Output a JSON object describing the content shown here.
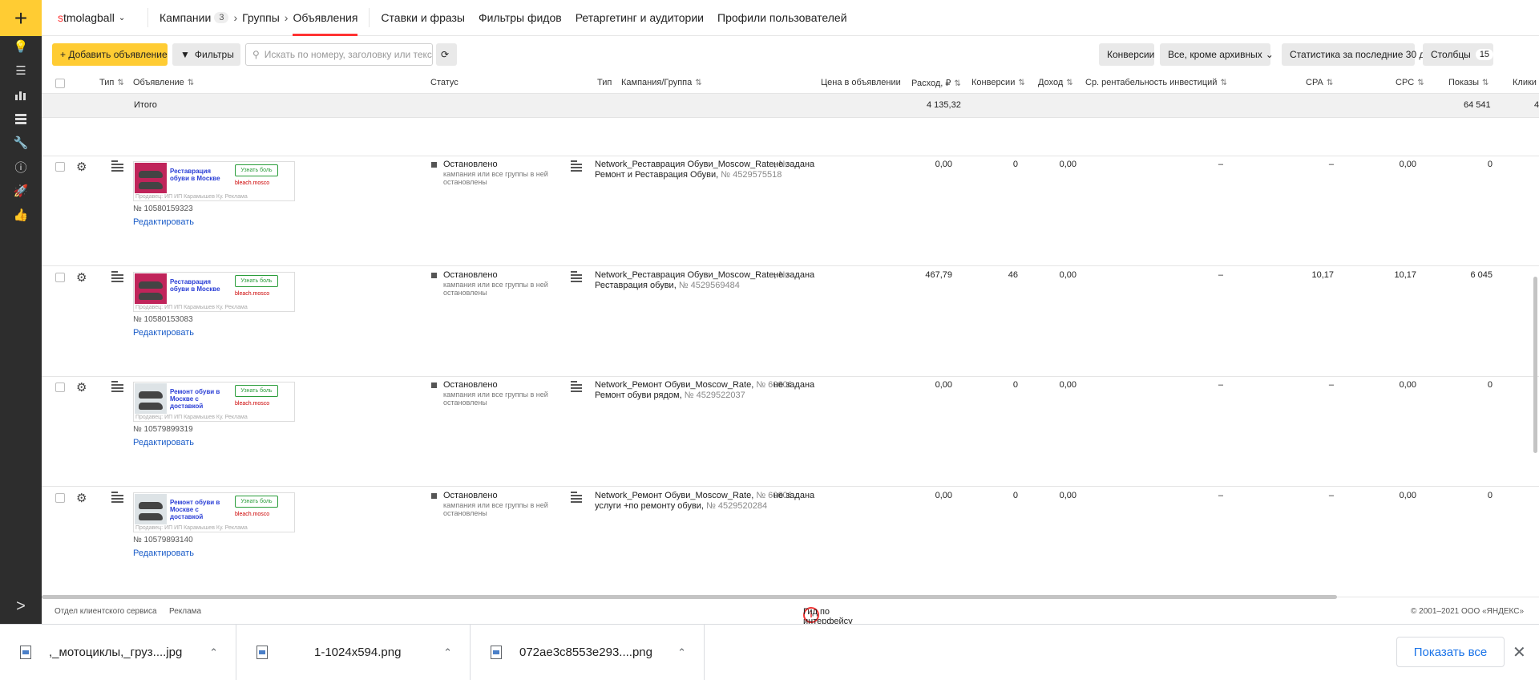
{
  "sidebar": {
    "add_symbol": "+",
    "icons": [
      "lightbulb-icon",
      "list-icon",
      "bar-chart-icon",
      "stack-icon",
      "wrench-icon",
      "info-icon",
      "rocket-icon",
      "thumb-up-icon"
    ],
    "expand_symbol": ">"
  },
  "topnav": {
    "login_first": "s",
    "login_rest": "tmolagball",
    "crumbs": {
      "campaigns": "Кампании",
      "campaigns_count": "3",
      "groups": "Группы",
      "ads": "Объявления"
    },
    "links": [
      "Ставки и фразы",
      "Фильтры фидов",
      "Ретаргетинг и аудитории",
      "Профили пользователей"
    ]
  },
  "toolbar": {
    "add_ad": "+ Добавить объявление",
    "filters": "Фильтры",
    "search_placeholder": "Искать по номеру, заголовку или тексту",
    "conversions": "Конверсии",
    "archive_filter": "Все, кроме архивных",
    "stats_period": "Статистика за последние 30 дней",
    "columns": "Столбцы",
    "columns_count": "15"
  },
  "table": {
    "headers": {
      "type_short": "Тип",
      "ad": "Объявление",
      "status": "Статус",
      "type": "Тип",
      "campaign_group": "Кампания/Группа",
      "price": "Цена в объявлении",
      "spend": "Расход, ₽",
      "conversions": "Конверсии",
      "income": "Доход",
      "roi": "Ср. рентабельность инвестиций",
      "cpa": "CPA",
      "cpc": "CPC",
      "impressions": "Показы",
      "clicks": "Клики"
    },
    "totals": {
      "label": "Итого",
      "spend": "4 135,32",
      "impressions": "64 541",
      "clicks_partial": "4"
    },
    "rows": [
      {
        "ad_title": "Реставрация обуви в Москве",
        "ad_cta": "Узнать боль",
        "ad_domain": "bleach.mosco",
        "ad_seller": "Продавец: ИП ИП Карамышев Ку. Реклама",
        "ad_number": "№ 10580159323",
        "edit": "Редактировать",
        "status": "Остановлено",
        "status_sub": "кампания или все группы в ней остановлены",
        "campaign": "Network_Реставрация Обуви_Moscow_Rate,",
        "campaign_num": "№ 6",
        "group": "Ремонт и Реставрация Обуви,",
        "group_num": "№ 4529575518",
        "price": "не задана",
        "spend": "0,00",
        "conversions": "0",
        "income": "0,00",
        "roi": "–",
        "cpa": "–",
        "cpc": "0,00",
        "impressions": "0",
        "image": "pink"
      },
      {
        "ad_title": "Реставрация обуви в Москве",
        "ad_cta": "Узнать боль",
        "ad_domain": "bleach.mosco",
        "ad_seller": "Продавец: ИП ИП Карамышев Ку. Реклама",
        "ad_number": "№ 10580153083",
        "edit": "Редактировать",
        "status": "Остановлено",
        "status_sub": "кампания или все группы в ней остановлены",
        "campaign": "Network_Реставрация Обуви_Moscow_Rate,",
        "campaign_num": "№ 6",
        "group": "Реставрация обуви,",
        "group_num": "№ 4529569484",
        "price": "не задана",
        "spend": "467,79",
        "conversions": "46",
        "income": "0,00",
        "roi": "–",
        "cpa": "10,17",
        "cpc": "10,17",
        "impressions": "6 045",
        "image": "pink"
      },
      {
        "ad_title": "Ремонт обуви в Москве с доставкой",
        "ad_cta": "Узнать боль",
        "ad_domain": "bleach.mosco",
        "ad_seller": "Продавец: ИП ИП Карамышев Ку. Реклама",
        "ad_number": "№ 10579899319",
        "edit": "Редактировать",
        "status": "Остановлено",
        "status_sub": "кампания или все группы в ней остановлены",
        "campaign": "Network_Ремонт Обуви_Moscow_Rate,",
        "campaign_num": "№ 60606",
        "group": "Ремонт обуви рядом,",
        "group_num": "№ 4529522037",
        "price": "не задана",
        "spend": "0,00",
        "conversions": "0",
        "income": "0,00",
        "roi": "–",
        "cpa": "–",
        "cpc": "0,00",
        "impressions": "0",
        "image": "grey"
      },
      {
        "ad_title": "Ремонт обуви в Москве с доставкой",
        "ad_cta": "Узнать боль",
        "ad_domain": "bleach.mosco",
        "ad_seller": "Продавец: ИП ИП Карамышев Ку. Реклама",
        "ad_number": "№ 10579893140",
        "edit": "Редактировать",
        "status": "Остановлено",
        "status_sub": "кампания или все группы в ней остановлены",
        "campaign": "Network_Ремонт Обуви_Moscow_Rate,",
        "campaign_num": "№ 60606",
        "group": "услуги +по ремонту обуви,",
        "group_num": "№ 4529520284",
        "price": "не задана",
        "spend": "0,00",
        "conversions": "0",
        "income": "0,00",
        "roi": "–",
        "cpa": "–",
        "cpc": "0,00",
        "impressions": "0",
        "image": "grey"
      }
    ]
  },
  "footer": {
    "support": "Отдел клиентского сервиса",
    "ads": "Реклама",
    "guide": "Гид по интерфейсу",
    "copyright": "© 2001–2021  ООО «ЯНДЕКС»"
  },
  "downloads": {
    "items": [
      ",_мотоциклы,_груз....jpg",
      "1-1024x594.png",
      "072ae3c8553e293....png"
    ],
    "show_all": "Показать все",
    "close": "✕"
  }
}
